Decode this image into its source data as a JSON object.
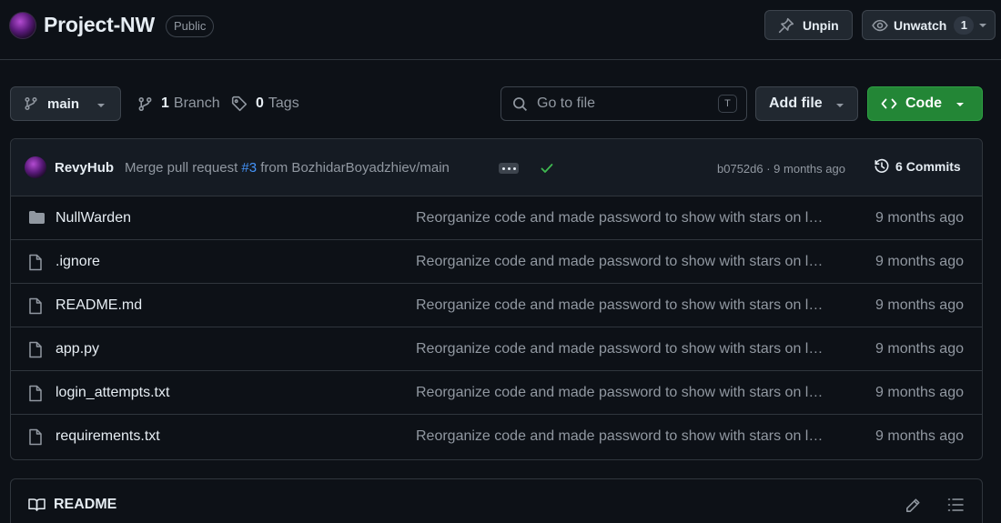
{
  "repo": {
    "name": "Project-NW",
    "visibility": "Public",
    "unpin_label": "Unpin",
    "unwatch_label": "Unwatch",
    "watch_count": "1"
  },
  "toolbar": {
    "branch": "main",
    "branch_count": "1",
    "branch_label": "Branch",
    "tag_count": "0",
    "tag_label": "Tags",
    "goto_placeholder": "Go to file",
    "goto_shortcut": "T",
    "add_file_label": "Add file",
    "code_label": "Code"
  },
  "latest_commit": {
    "author": "RevyHub",
    "message_prefix": "Merge pull request",
    "pr_number": "#3",
    "message_suffix": "from BozhidarBoyadzhiev/main",
    "status": "success",
    "sha_and_age": "b0752d6 · 9 months ago",
    "commit_count": "6",
    "commits_label": "Commits"
  },
  "files": [
    {
      "name": "NullWarden",
      "type": "folder",
      "commit": "Reorganize code and made password to show with stars on login",
      "age": "9 months ago"
    },
    {
      "name": ".ignore",
      "type": "file",
      "commit": "Reorganize code and made password to show with stars on login",
      "age": "9 months ago"
    },
    {
      "name": "README.md",
      "type": "file",
      "commit": "Reorganize code and made password to show with stars on login",
      "age": "9 months ago"
    },
    {
      "name": "app.py",
      "type": "file",
      "commit": "Reorganize code and made password to show with stars on login",
      "age": "9 months ago"
    },
    {
      "name": "login_attempts.txt",
      "type": "file",
      "commit": "Reorganize code and made password to show with stars on login",
      "age": "9 months ago"
    },
    {
      "name": "requirements.txt",
      "type": "file",
      "commit": "Reorganize code and made password to show with stars on login",
      "age": "9 months ago"
    }
  ],
  "readme": {
    "tab_label": "README"
  },
  "colors": {
    "background": "#0d1117",
    "accent_green": "#238636",
    "link_blue": "#4493f8",
    "muted": "#9198a1"
  }
}
